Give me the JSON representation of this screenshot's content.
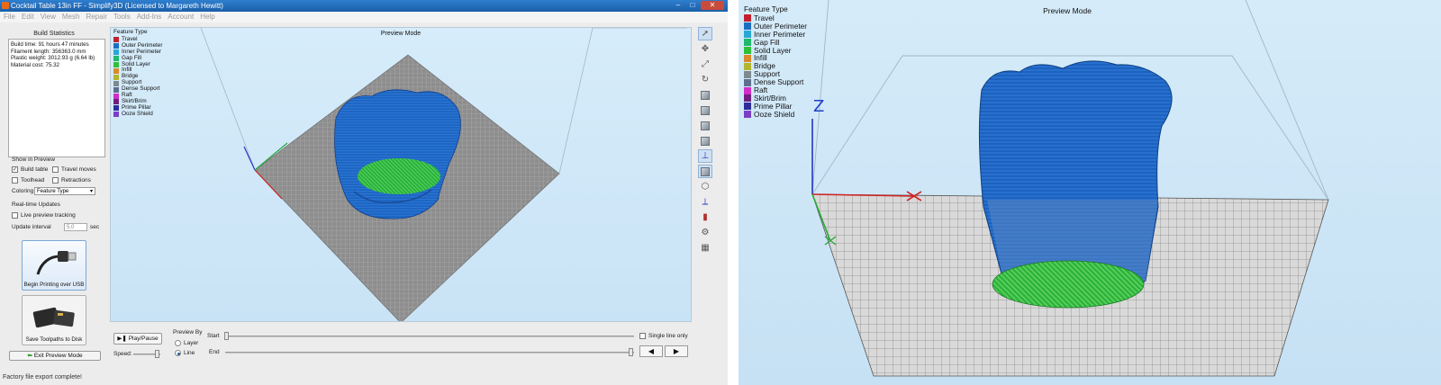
{
  "window": {
    "title": "Cocktail Table 13in FF - Simplify3D (Licensed to Margareth Hewitt)",
    "controls": [
      "–",
      "□",
      "✕"
    ]
  },
  "menu": [
    "File",
    "Edit",
    "View",
    "Mesh",
    "Repair",
    "Tools",
    "Add-Ins",
    "Account",
    "Help"
  ],
  "build_statistics": {
    "title": "Build Statistics",
    "lines": [
      "Build time: 91 hours 47 minutes",
      "Filament length: 356363.0 mm",
      "Plastic weight: 3012.93 g (6.64 lb)",
      "Material cost: 75.32"
    ]
  },
  "show_in_preview": {
    "title": "Show in Preview",
    "build_table": "Build table",
    "travel_moves": "Travel moves",
    "toolhead": "Toolhead",
    "retractions": "Retractions",
    "coloring_label": "Coloring",
    "coloring_value": "Feature Type"
  },
  "realtime": {
    "title": "Real-time Updates",
    "live_tracking": "Live preview tracking",
    "interval_label": "Update interval",
    "interval_value": "5.0",
    "interval_unit": "sec"
  },
  "buttons": {
    "usb": "Begin Printing over USB",
    "disk": "Save Toolpaths to Disk",
    "exit": "Exit Preview Mode",
    "play": "Play/Pause"
  },
  "status": "Factory file export complete!",
  "viewport": {
    "title": "Preview Mode",
    "legend_title": "Feature Type",
    "legend": [
      {
        "label": "Travel",
        "color": "#c3202f"
      },
      {
        "label": "Outer Perimeter",
        "color": "#1b6fc1"
      },
      {
        "label": "Inner Perimeter",
        "color": "#27a7d6"
      },
      {
        "label": "Gap Fill",
        "color": "#1fb86d"
      },
      {
        "label": "Solid Layer",
        "color": "#2fc03a"
      },
      {
        "label": "Infill",
        "color": "#d98a2a"
      },
      {
        "label": "Bridge",
        "color": "#b2b52d"
      },
      {
        "label": "Support",
        "color": "#7d8a8f"
      },
      {
        "label": "Dense Support",
        "color": "#5c6f8c"
      },
      {
        "label": "Raft",
        "color": "#d22cc9"
      },
      {
        "label": "Skirt/Brim",
        "color": "#6e1f7d"
      },
      {
        "label": "Prime Pillar",
        "color": "#2c2c9a"
      },
      {
        "label": "Ooze Shield",
        "color": "#7b3fc6"
      }
    ]
  },
  "preview_controls": {
    "speed_label": "Speed:",
    "preview_by": "Preview By",
    "layer": "Layer",
    "line": "Line",
    "start": "Start",
    "end": "End",
    "single_line": "Single line only",
    "prev": "◀",
    "next": "▶"
  },
  "zoom_view": {
    "title": "Preview Mode",
    "axis_z": "Z"
  }
}
